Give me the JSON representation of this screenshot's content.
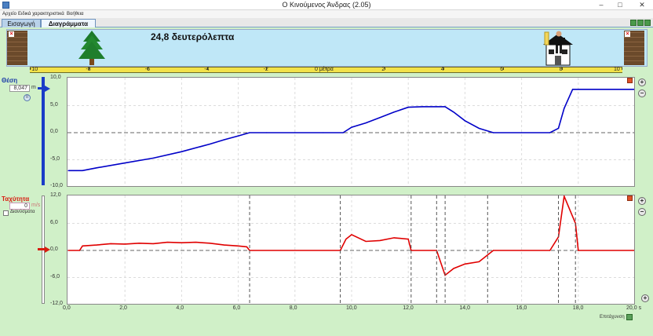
{
  "window": {
    "title": "Ο Κινούμενος Άνδρας (2.05)",
    "close_glyph": "✕",
    "min_glyph": "–",
    "max_glyph": "□"
  },
  "menu": [
    "Αρχείο",
    "Ειδικά χαρακτηριστικά",
    "Βοήθεια"
  ],
  "tabs": [
    {
      "label": "Εισαγωγή",
      "active": false
    },
    {
      "label": "Διαγράμματα",
      "active": true
    }
  ],
  "scene": {
    "time_text": "24,8 δευτερόλεπτα",
    "ruler_ticks": [
      "-10",
      "-8",
      "-6",
      "-4",
      "-2",
      "0 μέτρα",
      "2",
      "4",
      "6",
      "8",
      "10"
    ],
    "wall_close_glyph": "×"
  },
  "position_panel": {
    "title": "Θέση",
    "value": "8,047",
    "unit": "m",
    "pause_glyph": "II"
  },
  "velocity_panel": {
    "title": "Ταχύτητα",
    "value": "0",
    "unit": "m/s",
    "vectors_label": "Διανύσματα"
  },
  "colors": {
    "position": "#0000c8",
    "velocity": "#e00000",
    "panel_bg": "#d0f0c8",
    "scene_bg": "#bfe7f7",
    "ruler": "#f2e24a"
  },
  "icons": {
    "zoom_in": "zoom-in-icon",
    "zoom_out": "zoom-out-icon",
    "tree": "tree-icon",
    "house": "house-icon",
    "man": "man-icon",
    "pause": "pause-icon"
  },
  "continue_label": "Επιτάχυνση",
  "chart_data": [
    {
      "type": "line",
      "title": "",
      "xlabel": "",
      "ylabel": "Θέση",
      "xlim": [
        0,
        20
      ],
      "ylim": [
        -10,
        10
      ],
      "y_ticks": [
        "10,0",
        "5,0",
        "0,0",
        "-5,0",
        "-10,0"
      ],
      "grid": true,
      "series": [
        {
          "color": "#0000c8",
          "x": [
            0,
            0.5,
            1,
            2,
            3,
            4,
            5,
            5.5,
            6,
            6.4,
            7,
            8,
            9,
            9.7,
            10,
            10.5,
            11,
            11.5,
            12,
            12.5,
            13,
            13.3,
            13.6,
            14,
            14.5,
            15,
            16,
            17,
            17.3,
            17.5,
            17.8,
            18,
            19,
            20
          ],
          "y": [
            -7,
            -7,
            -6.5,
            -5.6,
            -4.7,
            -3.5,
            -2.1,
            -1.3,
            -0.6,
            0,
            0,
            0,
            0,
            0,
            1,
            1.8,
            2.8,
            3.8,
            4.7,
            4.8,
            4.8,
            4.8,
            3.8,
            2.2,
            0.8,
            0,
            0,
            0,
            0.8,
            4.5,
            8,
            8,
            8,
            8
          ]
        }
      ]
    },
    {
      "type": "line",
      "title": "",
      "xlabel": "",
      "ylabel": "Ταχύτητα",
      "xlim": [
        0,
        20
      ],
      "ylim": [
        -12,
        12
      ],
      "x_ticks": [
        "0,0",
        "2,0",
        "4,0",
        "6,0",
        "8,0",
        "10,0",
        "12,0",
        "14,0",
        "16,0",
        "18,0",
        "20,0 s"
      ],
      "y_ticks": [
        "12,0",
        "6,0",
        "0,0",
        "-6,0",
        "-12,0"
      ],
      "grid": true,
      "series": [
        {
          "color": "#e00000",
          "x": [
            0,
            0.4,
            0.5,
            1,
            1.5,
            2,
            2.5,
            3,
            3.5,
            4,
            4.5,
            5,
            5.5,
            6,
            6.3,
            6.4,
            9.6,
            9.8,
            10,
            10.5,
            11,
            11.5,
            12,
            12.1,
            13,
            13.3,
            13.6,
            14,
            14.5,
            14.8,
            15,
            17,
            17.3,
            17.5,
            17.9,
            18,
            20
          ],
          "y": [
            0,
            0,
            1,
            1.2,
            1.5,
            1.4,
            1.6,
            1.5,
            1.8,
            1.7,
            1.8,
            1.6,
            1.2,
            1.0,
            0.8,
            0,
            0,
            2.5,
            3.5,
            2.0,
            2.2,
            2.8,
            2.5,
            0,
            0,
            -5.5,
            -4.0,
            -3.0,
            -2.5,
            -1.0,
            0,
            0,
            3.0,
            12.0,
            6.0,
            0,
            0
          ]
        }
      ]
    }
  ]
}
